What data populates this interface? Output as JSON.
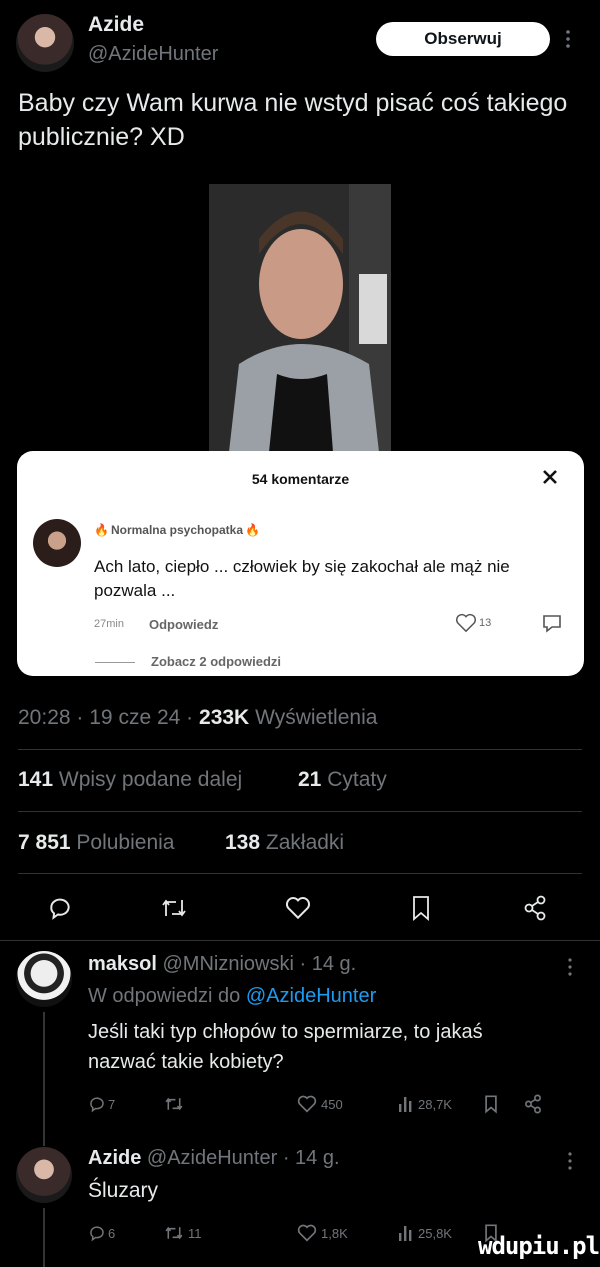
{
  "tweet": {
    "author_name": "Azide",
    "author_handle": "@AzideHunter",
    "follow_label": "Obserwuj",
    "text": "Baby czy Wam kurwa nie wstyd pisać coś takiego publicznie? XD",
    "time": "20:28",
    "sep": "·",
    "date": "19 cze 24",
    "views_count": "233K",
    "views_label": "Wyświetlenia",
    "reposts_count": "141",
    "reposts_label": "Wpisy podane dalej",
    "quotes_count": "21",
    "quotes_label": "Cytaty",
    "likes_count": "7 851",
    "likes_label": "Polubienia",
    "bookmarks_count": "138",
    "bookmarks_label": "Zakładki"
  },
  "embedded": {
    "header": "54 komentarze",
    "commenter": "Normalna psychopatka",
    "comment": "Ach lato, ciepło ... człowiek by się zakochał ale mąż nie pozwala ...",
    "time": "27min",
    "reply_label": "Odpowiedz",
    "likes": "13",
    "see_replies": "Zobacz 2 odpowiedzi"
  },
  "replies": [
    {
      "name": "maksol",
      "handle": "@MNizniowski",
      "age": "· 14 g.",
      "replying_prefix": "W odpowiedzi do",
      "replying_to": "@AzideHunter",
      "text": "Jeśli taki typ chłopów to spermiarze, to jakaś nazwać takie kobiety?",
      "replies": "7",
      "reposts": "",
      "likes": "450",
      "views": "28,7K"
    },
    {
      "name": "Azide",
      "handle": "@AzideHunter",
      "age": "· 14 g.",
      "text": "Śluzary",
      "replies": "6",
      "reposts": "11",
      "likes": "1,8K",
      "views": "25,8K"
    }
  ],
  "watermark": "wdupiu.pl",
  "colors": {
    "accent": "#1d9bf0",
    "muted": "#71767b",
    "background": "#000000"
  }
}
